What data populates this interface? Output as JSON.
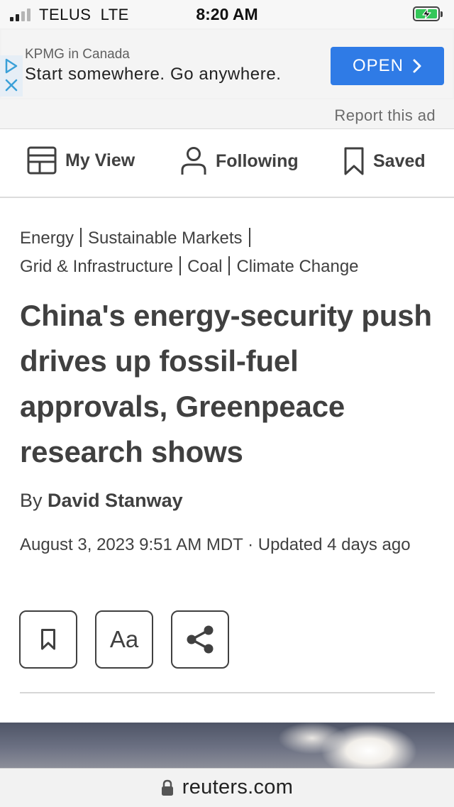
{
  "status_bar": {
    "carrier": "TELUS  LTE",
    "time": "8:20 AM",
    "battery_color": "#34c759"
  },
  "ad": {
    "sponsor": "KPMG in Canada",
    "headline": "Start somewhere. Go anywhere.",
    "cta_label": "OPEN",
    "cta_color": "#2f7be6",
    "report_label": "Report this ad"
  },
  "nav": {
    "items": [
      {
        "label": "My View",
        "icon": "layout-icon"
      },
      {
        "label": "Following",
        "icon": "person-icon"
      },
      {
        "label": "Saved",
        "icon": "bookmark-icon"
      }
    ]
  },
  "article": {
    "tags": [
      "Energy",
      "Sustainable Markets",
      "Grid & Infrastructure",
      "Coal",
      "Climate Change"
    ],
    "headline": "China's energy-security push drives up fossil-fuel approvals, Greenpeace research shows",
    "byline_prefix": "By",
    "author": "David Stanway",
    "dateline": "August 3, 2023 9:51 AM MDT · Updated 4 days ago",
    "text_size_label": "Aa",
    "tools": [
      "bookmark-icon",
      "text-size-icon",
      "share-icon"
    ]
  },
  "url_bar": {
    "domain": "reuters.com",
    "icon": "lock-icon"
  }
}
